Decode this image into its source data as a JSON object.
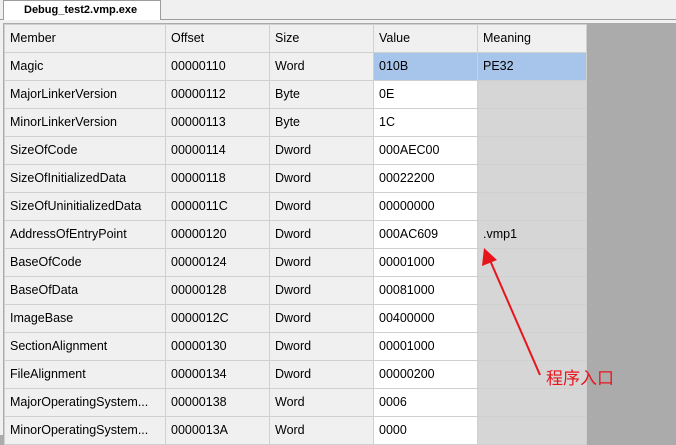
{
  "tab": {
    "title": "Debug_test2.vmp.exe"
  },
  "table": {
    "columns": [
      "Member",
      "Offset",
      "Size",
      "Value",
      "Meaning"
    ],
    "rows": [
      [
        "Magic",
        "00000110",
        "Word",
        "010B",
        "PE32"
      ],
      [
        "MajorLinkerVersion",
        "00000112",
        "Byte",
        "0E",
        ""
      ],
      [
        "MinorLinkerVersion",
        "00000113",
        "Byte",
        "1C",
        ""
      ],
      [
        "SizeOfCode",
        "00000114",
        "Dword",
        "000AEC00",
        ""
      ],
      [
        "SizeOfInitializedData",
        "00000118",
        "Dword",
        "00022200",
        ""
      ],
      [
        "SizeOfUninitializedData",
        "0000011C",
        "Dword",
        "00000000",
        ""
      ],
      [
        "AddressOfEntryPoint",
        "00000120",
        "Dword",
        "000AC609",
        ".vmp1"
      ],
      [
        "BaseOfCode",
        "00000124",
        "Dword",
        "00001000",
        ""
      ],
      [
        "BaseOfData",
        "00000128",
        "Dword",
        "00081000",
        ""
      ],
      [
        "ImageBase",
        "0000012C",
        "Dword",
        "00400000",
        ""
      ],
      [
        "SectionAlignment",
        "00000130",
        "Dword",
        "00001000",
        ""
      ],
      [
        "FileAlignment",
        "00000134",
        "Dword",
        "00000200",
        ""
      ],
      [
        "MajorOperatingSystem...",
        "00000138",
        "Word",
        "0006",
        ""
      ],
      [
        "MinorOperatingSystem...",
        "0000013A",
        "Word",
        "0000",
        ""
      ]
    ]
  },
  "annotation": {
    "text": "程序入口",
    "color": "#e8141c"
  },
  "colors": {
    "selected_row": "#a7c5ea",
    "meaning_column": "#d6d6d6",
    "background": "#ababab"
  }
}
